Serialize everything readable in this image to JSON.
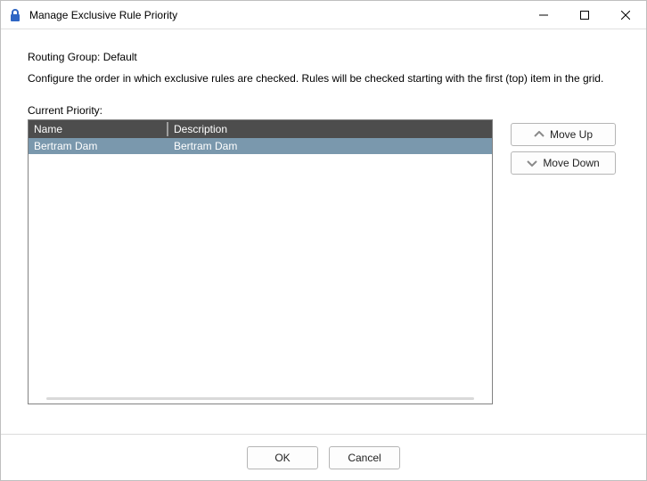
{
  "window": {
    "title": "Manage Exclusive Rule Priority"
  },
  "header": {
    "routing_group_label": "Routing Group:",
    "routing_group_value": "Default",
    "instructions": "Configure the order in which exclusive rules are checked. Rules will be checked starting with the first (top) item in the grid.",
    "current_priority_label": "Current Priority:"
  },
  "grid": {
    "columns": {
      "name": "Name",
      "description": "Description"
    },
    "rows": [
      {
        "name": "Bertram Dam",
        "description": "Bertram Dam",
        "selected": true
      }
    ]
  },
  "buttons": {
    "move_up": "Move Up",
    "move_down": "Move Down",
    "ok": "OK",
    "cancel": "Cancel"
  }
}
